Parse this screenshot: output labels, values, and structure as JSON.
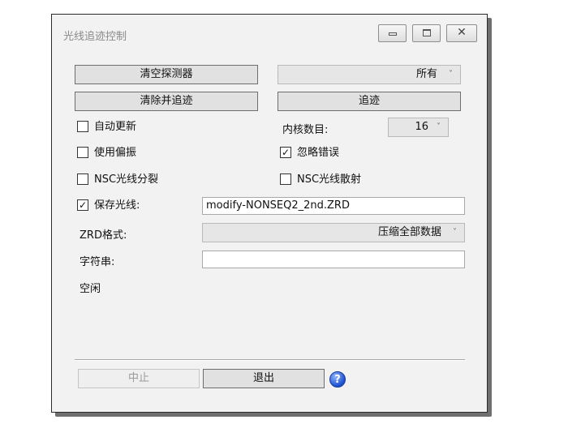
{
  "window": {
    "title": "光线追迹控制",
    "controls": {
      "minimize": "minimize-icon",
      "maximize": "maximize-icon",
      "close": "close-icon"
    }
  },
  "buttons": {
    "clear_detectors": "清空探测器",
    "clear_and_trace": "清除并追迹",
    "trace": "追迹",
    "stop": "中止",
    "exit": "退出"
  },
  "detector_select": {
    "value": "所有"
  },
  "cores": {
    "label": "内核数目:",
    "value": "16"
  },
  "checkboxes": {
    "auto_update": {
      "label": "自动更新",
      "checked": false
    },
    "use_polarization": {
      "label": "使用偏振",
      "checked": false
    },
    "ignore_errors": {
      "label": "忽略错误",
      "checked": true
    },
    "nsc_ray_split": {
      "label": "NSC光线分裂",
      "checked": false
    },
    "nsc_ray_scatter": {
      "label": "NSC光线散射",
      "checked": false
    },
    "save_rays": {
      "label": "保存光线:",
      "checked": true
    }
  },
  "save_rays_file": "modify-NONSEQ2_2nd.ZRD",
  "zrd_format": {
    "label": "ZRD格式:",
    "value": "压缩全部数据"
  },
  "filter_string": {
    "label": "字符串:",
    "value": ""
  },
  "status": "空闲",
  "help": {
    "glyph": "?"
  }
}
